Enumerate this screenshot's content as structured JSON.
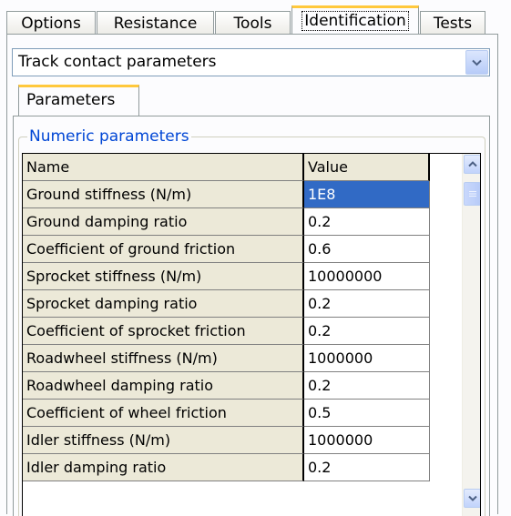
{
  "tabs": [
    {
      "label": "Options"
    },
    {
      "label": "Resistance"
    },
    {
      "label": "Tools"
    },
    {
      "label": "Identification"
    },
    {
      "label": "Tests"
    }
  ],
  "active_tab": "Identification",
  "combo": {
    "value": "Track contact parameters",
    "icon": "chevron-down-icon"
  },
  "subtab": {
    "label": "Parameters"
  },
  "group": {
    "legend": "Numeric parameters"
  },
  "grid": {
    "columns": {
      "name": "Name",
      "value": "Value"
    },
    "rows": [
      {
        "name": "Ground stiffness (N/m)",
        "value": "1E8"
      },
      {
        "name": "Ground damping ratio",
        "value": "0.2"
      },
      {
        "name": "Coefficient of ground friction",
        "value": "0.6"
      },
      {
        "name": "Sprocket stiffness (N/m)",
        "value": "10000000"
      },
      {
        "name": "Sprocket damping ratio",
        "value": "0.2"
      },
      {
        "name": "Coefficient of sprocket friction",
        "value": "0.2"
      },
      {
        "name": "Roadwheel stiffness (N/m)",
        "value": "1000000"
      },
      {
        "name": "Roadwheel damping ratio",
        "value": "0.2"
      },
      {
        "name": "Coefficient of wheel friction",
        "value": "0.5"
      },
      {
        "name": "Idler stiffness (N/m)",
        "value": "1000000"
      },
      {
        "name": "Idler damping ratio",
        "value": "0.2"
      }
    ],
    "selected_row": 0
  },
  "colors": {
    "accent": "#ffc83c",
    "selection": "#316ac5",
    "legend": "#0046d5"
  }
}
